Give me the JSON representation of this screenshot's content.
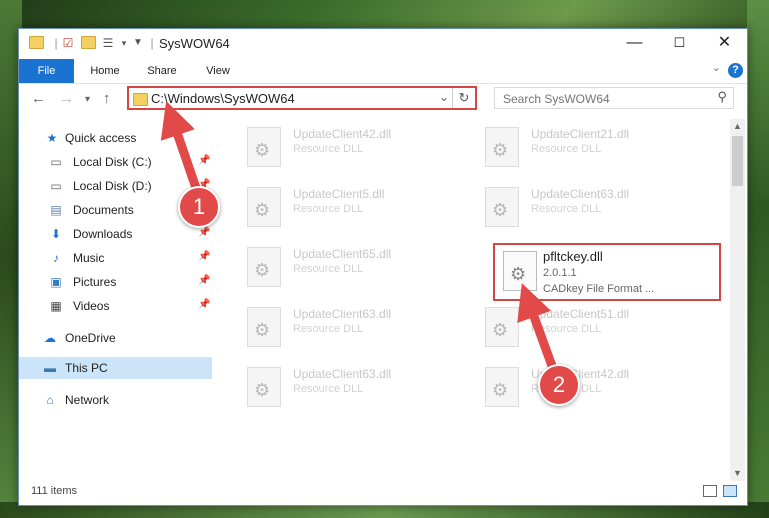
{
  "window": {
    "title": "SysWOW64",
    "controls": {
      "minimize": "—",
      "maximize": "☐",
      "close": "✕"
    }
  },
  "ribbon": {
    "tabs": [
      {
        "label": "File",
        "active": true
      },
      {
        "label": "Home"
      },
      {
        "label": "Share"
      },
      {
        "label": "View"
      }
    ],
    "help": "?"
  },
  "address": {
    "path": "C:\\Windows\\SysWOW64"
  },
  "search": {
    "placeholder": "Search SysWOW64"
  },
  "sidebar": {
    "items": [
      {
        "label": "Quick access",
        "icon": "star-icon"
      },
      {
        "label": "Local Disk (C:)",
        "icon": "drive-icon",
        "pinned": true
      },
      {
        "label": "Local Disk (D:)",
        "icon": "drive-icon",
        "pinned": true
      },
      {
        "label": "Documents",
        "icon": "document-icon",
        "pinned": true
      },
      {
        "label": "Downloads",
        "icon": "download-icon",
        "pinned": true
      },
      {
        "label": "Music",
        "icon": "music-icon",
        "pinned": true
      },
      {
        "label": "Pictures",
        "icon": "picture-icon",
        "pinned": true
      },
      {
        "label": "Videos",
        "icon": "video-icon",
        "pinned": true
      },
      {
        "label": "OneDrive",
        "icon": "cloud-icon"
      },
      {
        "label": "This PC",
        "icon": "computer-icon",
        "selected": true
      },
      {
        "label": "Network",
        "icon": "network-icon"
      }
    ]
  },
  "files": [
    {
      "name": "UpdateClient42.dll",
      "type": "Resource DLL"
    },
    {
      "name": "UpdateClient21.dll",
      "type": "Resource DLL"
    },
    {
      "name": "UpdateClient5.dll",
      "type": "Resource DLL"
    },
    {
      "name": "UpdateClient63.dll",
      "type": "Resource DLL"
    },
    {
      "name": "UpdateClient65.dll",
      "type": "Resource DLL"
    },
    {
      "name": "pfltckey.dll",
      "version": "2.0.1.1",
      "type": "CADkey File Format ...",
      "highlighted": true
    },
    {
      "name": "UpdateClient63.dll",
      "type": "Resource DLL"
    },
    {
      "name": "UpdateClient51.dll",
      "type": "Resource DLL"
    },
    {
      "name": "UpdateClient63.dll",
      "type": "Resource DLL"
    },
    {
      "name": "UpdateClient42.dll",
      "type": "Resource DLL"
    }
  ],
  "status": {
    "item_count": "111 items"
  },
  "callouts": [
    {
      "number": "1"
    },
    {
      "number": "2"
    }
  ],
  "colors": {
    "accent": "#1a73d0",
    "highlight_border": "#d64545",
    "callout": "#e24a4a"
  }
}
